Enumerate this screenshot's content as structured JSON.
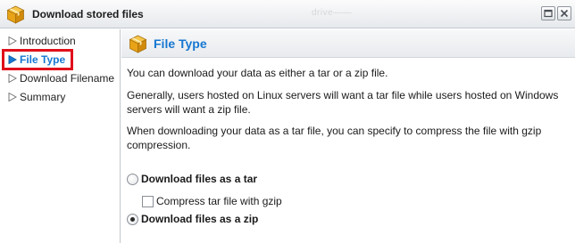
{
  "window": {
    "title": "Download stored files",
    "ghost_text": "drive——",
    "icon": "package-icon",
    "controls": [
      "restore-icon",
      "close-icon"
    ]
  },
  "nav": {
    "items": [
      {
        "label": "Introduction",
        "active": false
      },
      {
        "label": "File Type",
        "active": true
      },
      {
        "label": "Download Filename",
        "active": false
      },
      {
        "label": "Summary",
        "active": false
      }
    ]
  },
  "section": {
    "title": "File Type",
    "icon": "package-icon",
    "paragraphs": [
      "You can download your data as either a tar or a zip file.",
      "Generally, users hosted on Linux servers will want a tar file while users hosted on Windows servers will want a zip file.",
      "When downloading your data as a tar file, you can specify to compress the file with gzip compression."
    ]
  },
  "options": {
    "tar": {
      "label": "Download files as a tar",
      "checked": false
    },
    "gzip": {
      "label": "Compress tar file with gzip",
      "checked": false
    },
    "zip": {
      "label": "Download files as a zip",
      "checked": true
    }
  },
  "colors": {
    "accent": "#1677d2",
    "highlight_border": "#e0101b",
    "package": "#e8a317"
  }
}
